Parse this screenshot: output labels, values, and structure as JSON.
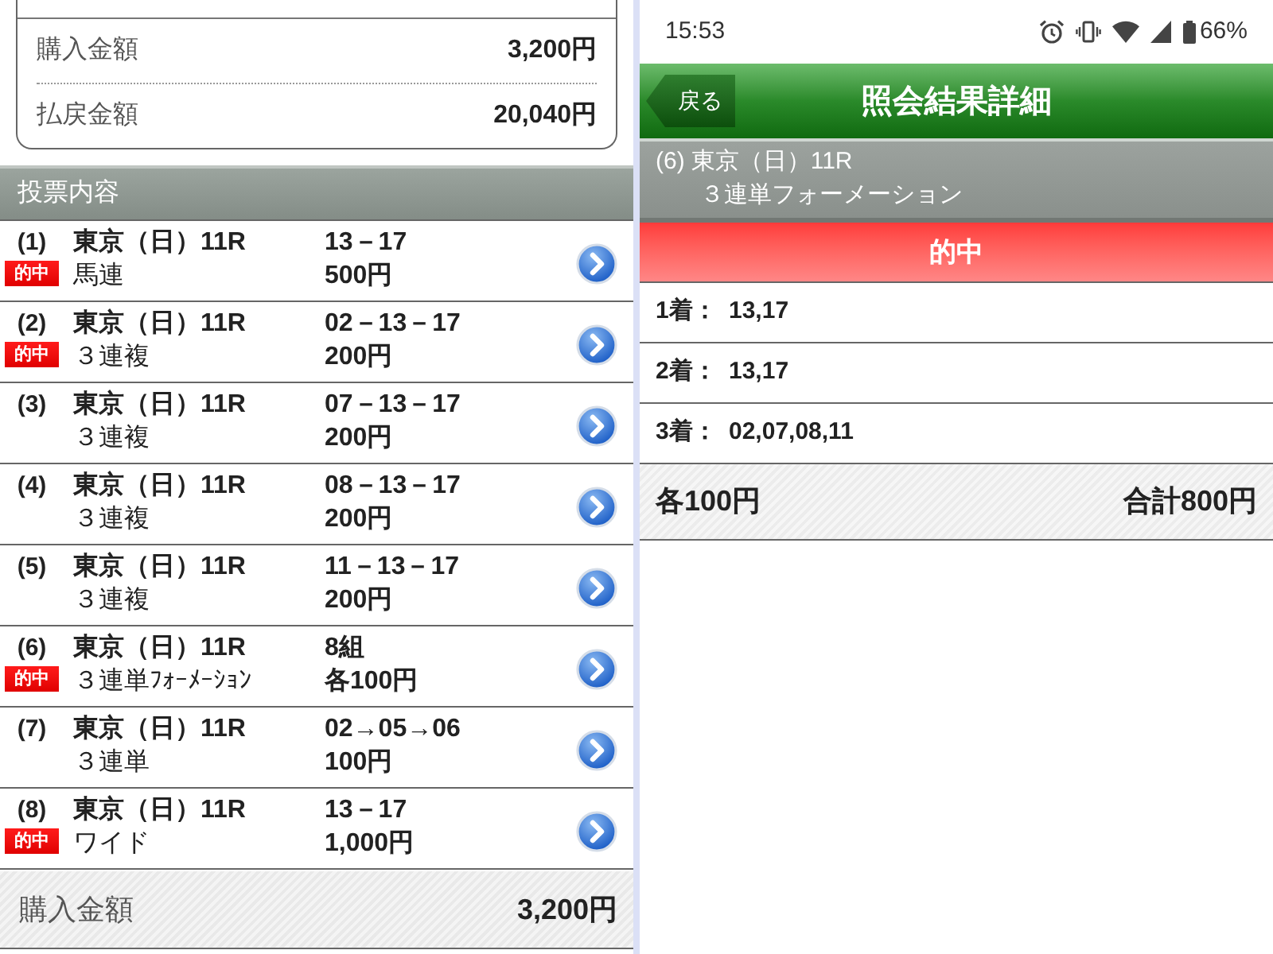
{
  "left_screen": {
    "summary": [
      {
        "label": "購入金額",
        "value": "3,200円"
      },
      {
        "label": "払戻金額",
        "value": "20,040円"
      }
    ],
    "section_title": "投票内容",
    "bets": [
      {
        "number": "(1)",
        "race": "東京（日）11R",
        "bet_type": "馬連",
        "combination": "13－17",
        "amount": "500円",
        "hit": true,
        "badge": "的中"
      },
      {
        "number": "(2)",
        "race": "東京（日）11R",
        "bet_type": "３連複",
        "combination": "02－13－17",
        "amount": "200円",
        "hit": true,
        "badge": "的中"
      },
      {
        "number": "(3)",
        "race": "東京（日）11R",
        "bet_type": "３連複",
        "combination": "07－13－17",
        "amount": "200円",
        "hit": false
      },
      {
        "number": "(4)",
        "race": "東京（日）11R",
        "bet_type": "３連複",
        "combination": "08－13－17",
        "amount": "200円",
        "hit": false
      },
      {
        "number": "(5)",
        "race": "東京（日）11R",
        "bet_type": "３連複",
        "combination": "11－13－17",
        "amount": "200円",
        "hit": false
      },
      {
        "number": "(6)",
        "race": "東京（日）11R",
        "bet_type": "３連単ﾌｫｰﾒｰｼｮﾝ",
        "combination": "8組",
        "amount": "各100円",
        "hit": true,
        "badge": "的中"
      },
      {
        "number": "(7)",
        "race": "東京（日）11R",
        "bet_type": "３連単",
        "combination": "02→05→06",
        "amount": "100円",
        "hit": false
      },
      {
        "number": "(8)",
        "race": "東京（日）11R",
        "bet_type": "ワイド",
        "combination": "13－17",
        "amount": "1,000円",
        "hit": true,
        "badge": "的中"
      }
    ],
    "footer": {
      "label": "購入金額",
      "value": "3,200円"
    }
  },
  "right_screen": {
    "status_bar": {
      "time": "15:53",
      "battery": "66%"
    },
    "header": {
      "back_button": "戻る",
      "title": "照会結果詳細"
    },
    "bet_info": {
      "number": "(6)",
      "race": "東京（日）11R",
      "bet_type": "３連単フォーメーション"
    },
    "result_banner": "的中",
    "placings": [
      {
        "label": "1着：",
        "value": "13,17"
      },
      {
        "label": "2着：",
        "value": "13,17"
      },
      {
        "label": "3着：",
        "value": "02,07,08,11"
      }
    ],
    "footer": {
      "unit_amount": "各100円",
      "total": "合計800円"
    }
  }
}
